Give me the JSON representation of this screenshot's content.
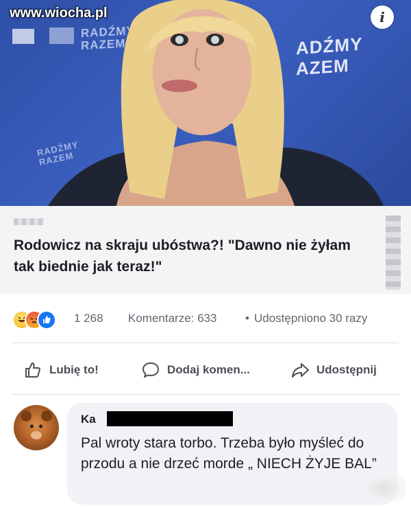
{
  "watermark": "www.wiocha.pl",
  "photo": {
    "banner_left": "RADŹMY\nRAZEM",
    "banner_right": "ADŹMY\nAZEM",
    "banner_bottom": "RADŹMY\nRAZEM",
    "info_icon": "info-icon",
    "info_label": "i"
  },
  "post": {
    "title": "Rodowicz na skraju ubóstwa?! \"Dawno nie żyłam tak biednie jak teraz!\""
  },
  "stats": {
    "reaction_icons": [
      "haha-icon",
      "angry-icon",
      "like-icon"
    ],
    "reaction_count": "1 268",
    "comments": "Komentarze: 633",
    "separator": "•",
    "shares": "Udostępniono 30 razy"
  },
  "actions": {
    "like_label": "Lubię to!",
    "comment_label": "Dodaj komen...",
    "share_label": "Udostępnij"
  },
  "comment": {
    "author": "Ka",
    "text": "Pal wroty stara torbo. Trzeba było myśleć do przodu a nie drzeć morde „ NIECH ŻYJE BAL”"
  },
  "colors": {
    "facebook_blue": "#1877f2",
    "text_primary": "#1c1e21",
    "text_secondary": "#606770",
    "bubble_bg": "#f0f2f5",
    "headline_bg": "#f3f4f6",
    "photo_bg": "#3b5fbf"
  }
}
